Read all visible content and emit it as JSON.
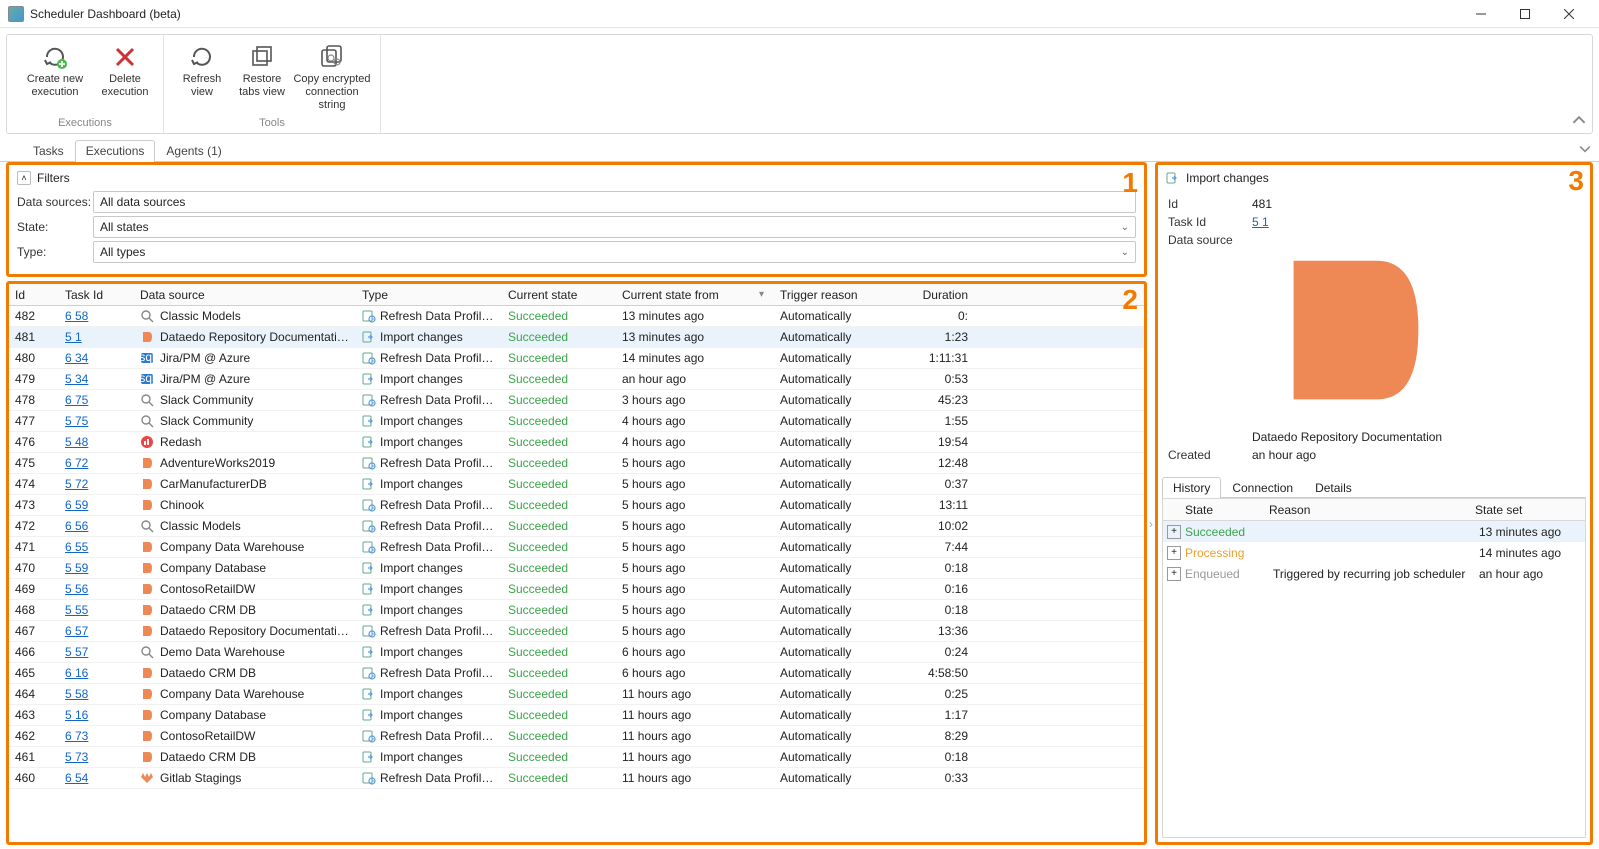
{
  "window": {
    "title": "Scheduler Dashboard (beta)"
  },
  "ribbon": {
    "groups": [
      {
        "label": "Executions",
        "buttons": [
          {
            "name": "create-new-execution",
            "icon": "refresh-plus",
            "label": "Create new\nexecution"
          },
          {
            "name": "delete-execution",
            "icon": "x-red",
            "label": "Delete\nexecution"
          }
        ]
      },
      {
        "label": "Tools",
        "buttons": [
          {
            "name": "refresh-view",
            "icon": "refresh",
            "label": "Refresh\nview"
          },
          {
            "name": "restore-tabs-view",
            "icon": "restore",
            "label": "Restore\ntabs view"
          },
          {
            "name": "copy-encrypted-connection-string",
            "icon": "copy-link",
            "label": "Copy encrypted\nconnection string"
          }
        ]
      }
    ]
  },
  "tabs": [
    {
      "label": "Tasks",
      "active": false
    },
    {
      "label": "Executions",
      "active": true
    },
    {
      "label": "Agents (1)",
      "active": false
    }
  ],
  "filters": {
    "title": "Filters",
    "rows": [
      {
        "label": "Data sources:",
        "value": "All data sources",
        "dropdown": false
      },
      {
        "label": "State:",
        "value": "All states",
        "dropdown": true
      },
      {
        "label": "Type:",
        "value": "All types",
        "dropdown": true
      }
    ]
  },
  "grid": {
    "headers": {
      "id": "Id",
      "taskId": "Task Id",
      "dataSource": "Data source",
      "type": "Type",
      "state": "Current state",
      "stateFrom": "Current state from",
      "trigger": "Trigger reason",
      "duration": "Duration"
    },
    "rows": [
      {
        "id": "482",
        "taskId": "6  58",
        "ds": "Classic Models",
        "dsIcon": "magnifier",
        "type": "Refresh Data Profiling",
        "typeIcon": "profiling",
        "state": "Succeeded",
        "from": "13 minutes ago",
        "trigger": "Automatically",
        "dur": "0:",
        "sel": false
      },
      {
        "id": "481",
        "taskId": "5  1",
        "ds": "Dataedo Repository Documentation",
        "dsIcon": "dataedo",
        "type": "Import changes",
        "typeIcon": "import",
        "state": "Succeeded",
        "from": "13 minutes ago",
        "trigger": "Automatically",
        "dur": "1:23",
        "sel": true
      },
      {
        "id": "480",
        "taskId": "6  34",
        "ds": "Jira/PM @ Azure",
        "dsIcon": "azure",
        "type": "Refresh Data Profiling",
        "typeIcon": "profiling",
        "state": "Succeeded",
        "from": "14 minutes ago",
        "trigger": "Automatically",
        "dur": "1:11:31",
        "sel": false
      },
      {
        "id": "479",
        "taskId": "5  34",
        "ds": "Jira/PM @ Azure",
        "dsIcon": "azure",
        "type": "Import changes",
        "typeIcon": "import",
        "state": "Succeeded",
        "from": "an hour ago",
        "trigger": "Automatically",
        "dur": "0:53",
        "sel": false
      },
      {
        "id": "478",
        "taskId": "6  75",
        "ds": "Slack Community",
        "dsIcon": "magnifier",
        "type": "Refresh Data Profiling",
        "typeIcon": "profiling",
        "state": "Succeeded",
        "from": "3 hours ago",
        "trigger": "Automatically",
        "dur": "45:23",
        "sel": false
      },
      {
        "id": "477",
        "taskId": "5  75",
        "ds": "Slack Community",
        "dsIcon": "magnifier",
        "type": "Import changes",
        "typeIcon": "import",
        "state": "Succeeded",
        "from": "4 hours ago",
        "trigger": "Automatically",
        "dur": "1:55",
        "sel": false
      },
      {
        "id": "476",
        "taskId": "5  48",
        "ds": "Redash",
        "dsIcon": "redash",
        "type": "Import changes",
        "typeIcon": "import",
        "state": "Succeeded",
        "from": "4 hours ago",
        "trigger": "Automatically",
        "dur": "19:54",
        "sel": false
      },
      {
        "id": "475",
        "taskId": "6  72",
        "ds": "AdventureWorks2019",
        "dsIcon": "dataedo",
        "type": "Refresh Data Profiling",
        "typeIcon": "profiling",
        "state": "Succeeded",
        "from": "5 hours ago",
        "trigger": "Automatically",
        "dur": "12:48",
        "sel": false
      },
      {
        "id": "474",
        "taskId": "5  72",
        "ds": "CarManufacturerDB",
        "dsIcon": "dataedo",
        "type": "Import changes",
        "typeIcon": "import",
        "state": "Succeeded",
        "from": "5 hours ago",
        "trigger": "Automatically",
        "dur": "0:37",
        "sel": false
      },
      {
        "id": "473",
        "taskId": "6  59",
        "ds": "Chinook",
        "dsIcon": "dataedo",
        "type": "Refresh Data Profiling",
        "typeIcon": "profiling",
        "state": "Succeeded",
        "from": "5 hours ago",
        "trigger": "Automatically",
        "dur": "13:11",
        "sel": false
      },
      {
        "id": "472",
        "taskId": "6  56",
        "ds": "Classic Models",
        "dsIcon": "magnifier",
        "type": "Refresh Data Profiling",
        "typeIcon": "profiling",
        "state": "Succeeded",
        "from": "5 hours ago",
        "trigger": "Automatically",
        "dur": "10:02",
        "sel": false
      },
      {
        "id": "471",
        "taskId": "6  55",
        "ds": "Company Data Warehouse",
        "dsIcon": "dataedo",
        "type": "Refresh Data Profiling",
        "typeIcon": "profiling",
        "state": "Succeeded",
        "from": "5 hours ago",
        "trigger": "Automatically",
        "dur": "7:44",
        "sel": false
      },
      {
        "id": "470",
        "taskId": "5  59",
        "ds": "Company Database",
        "dsIcon": "dataedo",
        "type": "Import changes",
        "typeIcon": "import",
        "state": "Succeeded",
        "from": "5 hours ago",
        "trigger": "Automatically",
        "dur": "0:18",
        "sel": false
      },
      {
        "id": "469",
        "taskId": "5  56",
        "ds": "ContosoRetailDW",
        "dsIcon": "dataedo",
        "type": "Import changes",
        "typeIcon": "import",
        "state": "Succeeded",
        "from": "5 hours ago",
        "trigger": "Automatically",
        "dur": "0:16",
        "sel": false
      },
      {
        "id": "468",
        "taskId": "5  55",
        "ds": "Dataedo CRM DB",
        "dsIcon": "dataedo",
        "type": "Import changes",
        "typeIcon": "import",
        "state": "Succeeded",
        "from": "5 hours ago",
        "trigger": "Automatically",
        "dur": "0:18",
        "sel": false
      },
      {
        "id": "467",
        "taskId": "6  57",
        "ds": "Dataedo Repository Documentation",
        "dsIcon": "dataedo",
        "type": "Refresh Data Profiling",
        "typeIcon": "profiling",
        "state": "Succeeded",
        "from": "5 hours ago",
        "trigger": "Automatically",
        "dur": "13:36",
        "sel": false
      },
      {
        "id": "466",
        "taskId": "5  57",
        "ds": "Demo Data Warehouse",
        "dsIcon": "magnifier",
        "type": "Import changes",
        "typeIcon": "import",
        "state": "Succeeded",
        "from": "6 hours ago",
        "trigger": "Automatically",
        "dur": "0:24",
        "sel": false
      },
      {
        "id": "465",
        "taskId": "6  16",
        "ds": "Dataedo CRM DB",
        "dsIcon": "dataedo",
        "type": "Refresh Data Profiling",
        "typeIcon": "profiling",
        "state": "Succeeded",
        "from": "6 hours ago",
        "trigger": "Automatically",
        "dur": "4:58:50",
        "sel": false
      },
      {
        "id": "464",
        "taskId": "5  58",
        "ds": "Company Data Warehouse",
        "dsIcon": "dataedo",
        "type": "Import changes",
        "typeIcon": "import",
        "state": "Succeeded",
        "from": "11 hours ago",
        "trigger": "Automatically",
        "dur": "0:25",
        "sel": false
      },
      {
        "id": "463",
        "taskId": "5  16",
        "ds": "Company Database",
        "dsIcon": "dataedo",
        "type": "Import changes",
        "typeIcon": "import",
        "state": "Succeeded",
        "from": "11 hours ago",
        "trigger": "Automatically",
        "dur": "1:17",
        "sel": false
      },
      {
        "id": "462",
        "taskId": "6  73",
        "ds": "ContosoRetailDW",
        "dsIcon": "dataedo",
        "type": "Refresh Data Profiling",
        "typeIcon": "profiling",
        "state": "Succeeded",
        "from": "11 hours ago",
        "trigger": "Automatically",
        "dur": "8:29",
        "sel": false
      },
      {
        "id": "461",
        "taskId": "5  73",
        "ds": "Dataedo CRM DB",
        "dsIcon": "dataedo",
        "type": "Import changes",
        "typeIcon": "import",
        "state": "Succeeded",
        "from": "11 hours ago",
        "trigger": "Automatically",
        "dur": "0:18",
        "sel": false
      },
      {
        "id": "460",
        "taskId": "6  54",
        "ds": "Gitlab Stagings",
        "dsIcon": "gitlab",
        "type": "Refresh Data Profiling",
        "typeIcon": "profiling",
        "state": "Succeeded",
        "from": "11 hours ago",
        "trigger": "Automatically",
        "dur": "0:33",
        "sel": false
      }
    ]
  },
  "details": {
    "header": {
      "icon": "import",
      "title": "Import changes"
    },
    "props": [
      {
        "label": "Id",
        "value": "481",
        "link": false
      },
      {
        "label": "Task Id",
        "value": "5  1",
        "link": true
      },
      {
        "label": "Data source",
        "value": "Dataedo Repository Documentation",
        "link": false,
        "icon": "dataedo"
      },
      {
        "label": "Created",
        "value": "an hour ago",
        "link": false
      }
    ],
    "subTabs": [
      {
        "label": "History",
        "active": true
      },
      {
        "label": "Connection",
        "active": false
      },
      {
        "label": "Details",
        "active": false
      }
    ],
    "history": {
      "headers": {
        "state": "State",
        "reason": "Reason",
        "stateSet": "State set"
      },
      "rows": [
        {
          "state": "Succeeded",
          "cls": "st-succ",
          "reason": "",
          "set": "13 minutes ago",
          "sel": true
        },
        {
          "state": "Processing",
          "cls": "st-proc",
          "reason": "",
          "set": "14 minutes ago",
          "sel": false
        },
        {
          "state": "Enqueued",
          "cls": "st-enq",
          "reason": "Triggered by recurring job scheduler",
          "set": "an hour ago",
          "sel": false
        }
      ]
    }
  },
  "overlays": {
    "n1": "1",
    "n2": "2",
    "n3": "3"
  }
}
